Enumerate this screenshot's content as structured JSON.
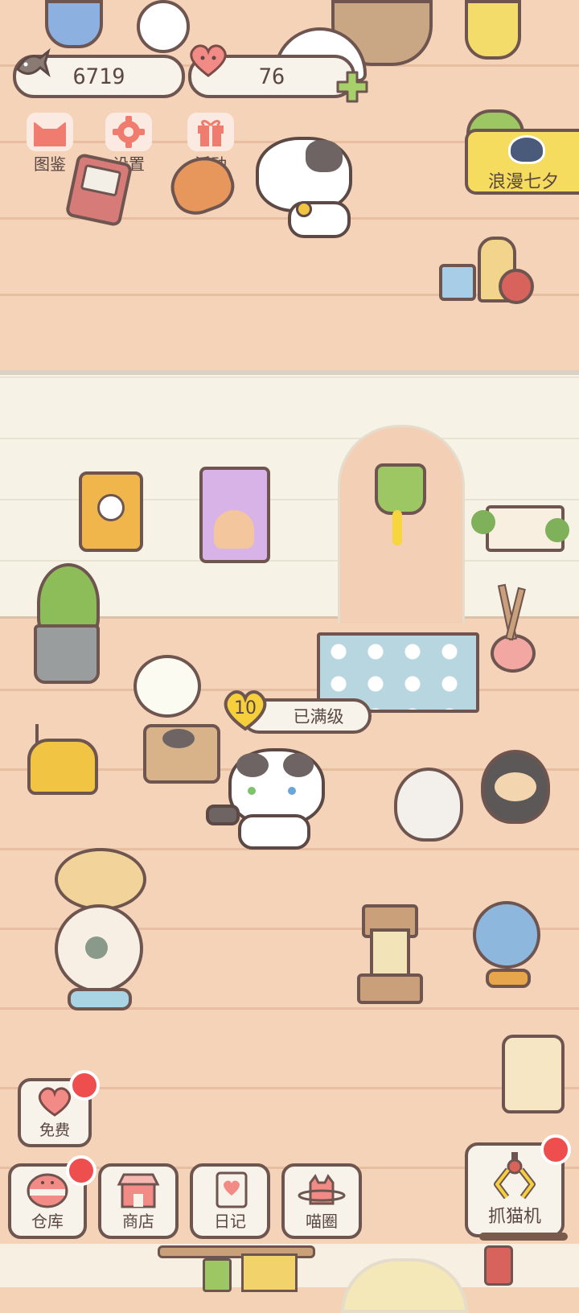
{
  "currency": {
    "fish_count": "6719",
    "heart_count": "76"
  },
  "top_menu": {
    "catalog_label": "图鉴",
    "settings_label": "设置",
    "events_label": "活动"
  },
  "event_banner": {
    "label": "浪漫七夕"
  },
  "cat_status": {
    "level": "10",
    "status_text": "已满级"
  },
  "free_button": {
    "label": "免费"
  },
  "bottom_nav": {
    "warehouse": "仓库",
    "shop": "商店",
    "diary": "日记",
    "cat_circle": "喵圈",
    "claw_machine": "抓猫机"
  },
  "colors": {
    "outline": "#6e5550",
    "badge_red": "#ef4e4e",
    "banner_yellow": "#f6dc5e",
    "heart_pink": "#f28a86",
    "plus_green": "#a8d06a"
  }
}
